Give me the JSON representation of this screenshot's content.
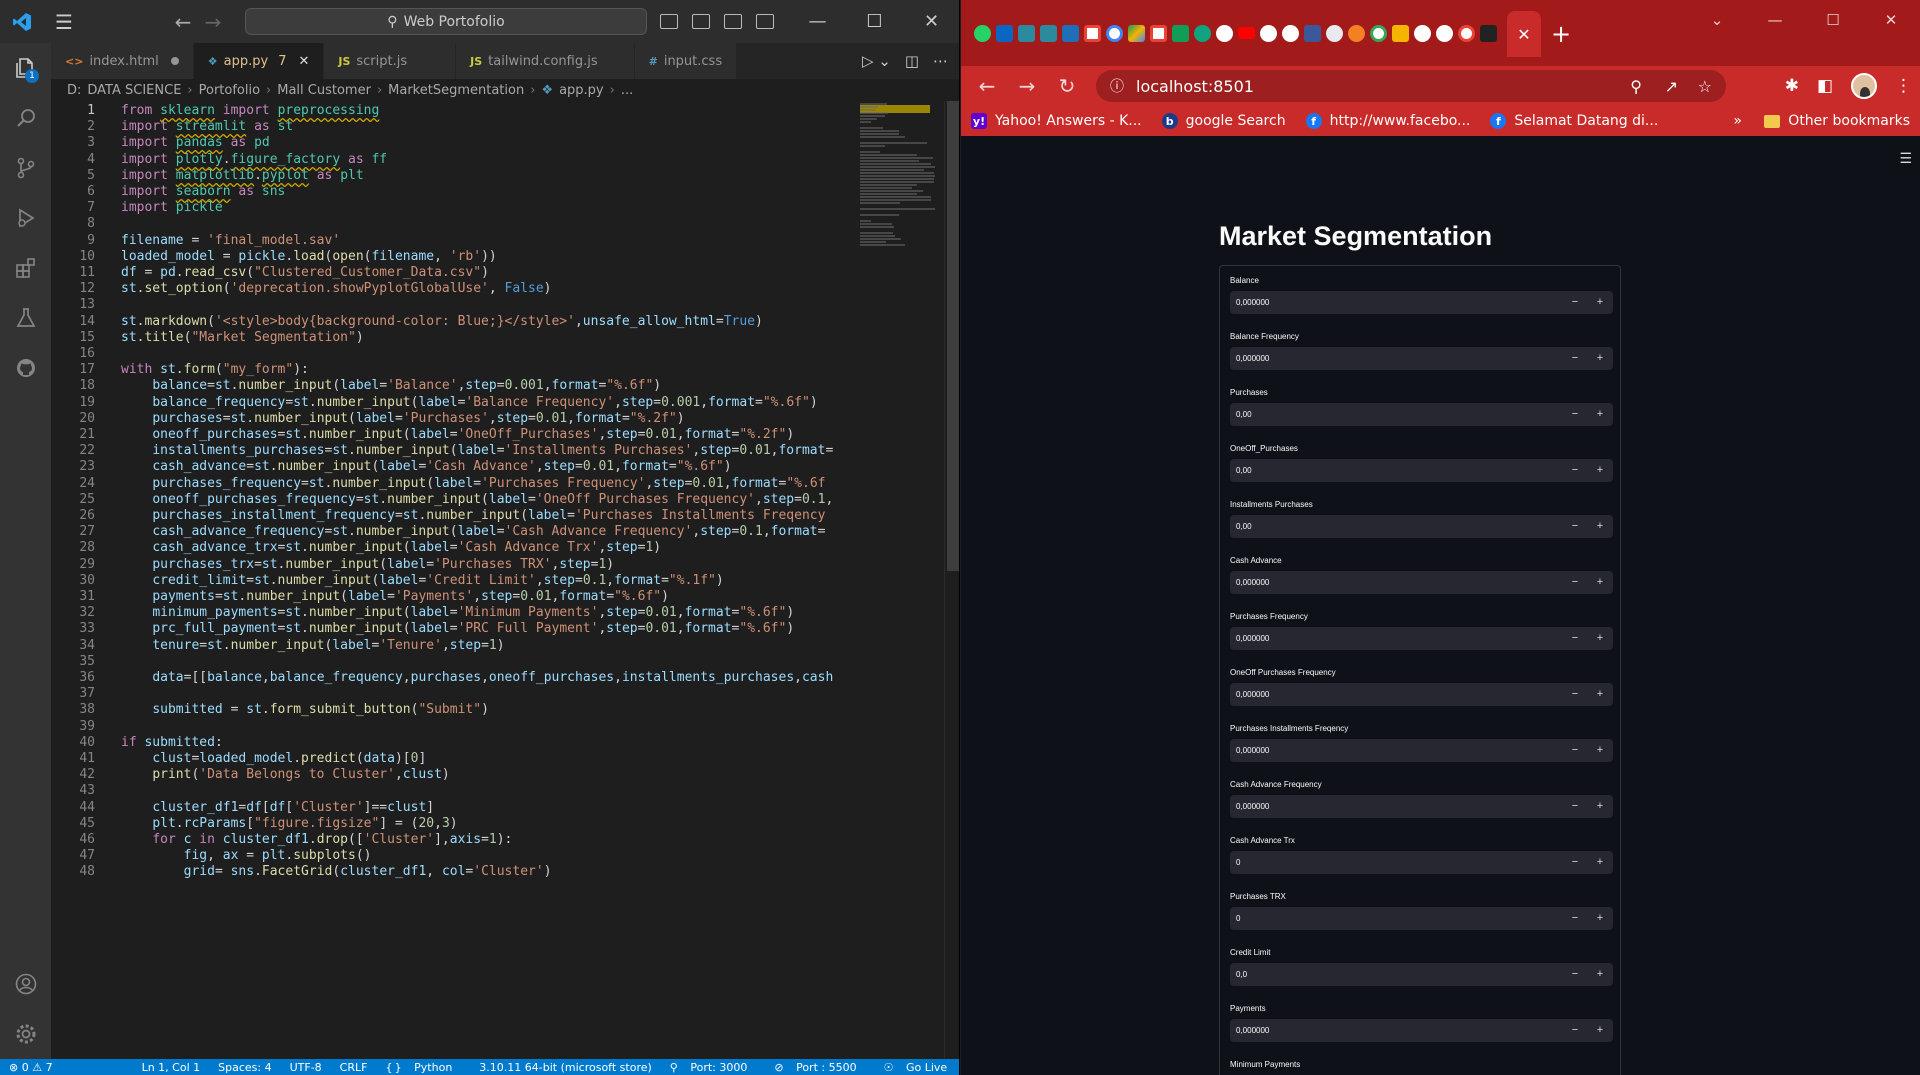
{
  "vscode": {
    "search_text": "Web Portofolio",
    "tabs": [
      {
        "name": "index.html",
        "icon": "<>",
        "kind": "html",
        "state": "unsaved"
      },
      {
        "name": "app.py",
        "icon": "py",
        "kind": "py",
        "state": "active",
        "problems": "7"
      },
      {
        "name": "script.js",
        "icon": "JS",
        "kind": "js",
        "state": ""
      },
      {
        "name": "tailwind.config.js",
        "icon": "JS",
        "kind": "js",
        "state": ""
      },
      {
        "name": "input.css",
        "icon": "#",
        "kind": "css",
        "state": ""
      }
    ],
    "explorer_badge": "1",
    "breadcrumb": [
      "D:",
      "DATA SCIENCE",
      "Portofolio",
      "Mall Customer",
      "MarketSegmentation",
      "app.py",
      "..."
    ],
    "code_lines": [
      "from sklearn import preprocessing",
      "import streamlit as st",
      "import pandas as pd",
      "import plotly.figure_factory as ff",
      "import matplotlib.pyplot as plt",
      "import seaborn as sns",
      "import pickle",
      "",
      "filename = 'final_model.sav'",
      "loaded_model = pickle.load(open(filename, 'rb'))",
      "df = pd.read_csv(\"Clustered_Customer_Data.csv\")",
      "st.set_option('deprecation.showPyplotGlobalUse', False)",
      "",
      "st.markdown('<style>body{background-color: Blue;}</style>',unsafe_allow_html=True)",
      "st.title(\"Market Segmentation\")",
      "",
      "with st.form(\"my_form\"):",
      "    balance=st.number_input(label='Balance',step=0.001,format=\"%.6f\")",
      "    balance_frequency=st.number_input(label='Balance Frequency',step=0.001,format=\"%.6f\")",
      "    purchases=st.number_input(label='Purchases',step=0.01,format=\"%.2f\")",
      "    oneoff_purchases=st.number_input(label='OneOff_Purchases',step=0.01,format=\"%.2f\")",
      "    installments_purchases=st.number_input(label='Installments Purchases',step=0.01,format=",
      "    cash_advance=st.number_input(label='Cash Advance',step=0.01,format=\"%.6f\")",
      "    purchases_frequency=st.number_input(label='Purchases Frequency',step=0.01,format=\"%.6f",
      "    oneoff_purchases_frequency=st.number_input(label='OneOff Purchases Frequency',step=0.1,",
      "    purchases_installment_frequency=st.number_input(label='Purchases Installments Freqency",
      "    cash_advance_frequency=st.number_input(label='Cash Advance Frequency',step=0.1,format=",
      "    cash_advance_trx=st.number_input(label='Cash Advance Trx',step=1)",
      "    purchases_trx=st.number_input(label='Purchases TRX',step=1)",
      "    credit_limit=st.number_input(label='Credit Limit',step=0.1,format=\"%.1f\")",
      "    payments=st.number_input(label='Payments',step=0.01,format=\"%.6f\")",
      "    minimum_payments=st.number_input(label='Minimum Payments',step=0.01,format=\"%.6f\")",
      "    prc_full_payment=st.number_input(label='PRC Full Payment',step=0.01,format=\"%.6f\")",
      "    tenure=st.number_input(label='Tenure',step=1)",
      "",
      "    data=[[balance,balance_frequency,purchases,oneoff_purchases,installments_purchases,cash",
      "",
      "    submitted = st.form_submit_button(\"Submit\")",
      "",
      "if submitted:",
      "    clust=loaded_model.predict(data)[0]",
      "    print('Data Belongs to Cluster',clust)",
      "",
      "    cluster_df1=df[df['Cluster']==clust]",
      "    plt.rcParams[\"figure.figsize\"] = (20,3)",
      "    for c in cluster_df1.drop(['Cluster'],axis=1):",
      "        fig, ax = plt.subplots()",
      "        grid= sns.FacetGrid(cluster_df1, col='Cluster')"
    ],
    "status": {
      "problems": "⊗ 0 ⚠ 7",
      "position": "Ln 1, Col 1",
      "spaces": "Spaces: 4",
      "encoding": "UTF-8",
      "eol": "CRLF",
      "language": "Python",
      "interpreter": "3.10.11 64-bit (microsoft store)",
      "port1": "Port: 3000",
      "port2": "Port : 5500",
      "golive": "Go Live"
    }
  },
  "chrome": {
    "url": "localhost:8501",
    "bookmarks": [
      "Yahoo! Answers - K...",
      "google Search",
      "http://www.facebo...",
      "Selamat Datang di..."
    ],
    "bookmarks_more": "»",
    "other_bookmarks": "Other bookmarks",
    "colors": {
      "frame": "#a31a1a",
      "toolbar": "#c92a2a"
    }
  },
  "streamlit": {
    "title": "Market Segmentation",
    "fields": [
      {
        "label": "Balance",
        "value": "0,000000"
      },
      {
        "label": "Balance Frequency",
        "value": "0,000000"
      },
      {
        "label": "Purchases",
        "value": "0,00"
      },
      {
        "label": "OneOff_Purchases",
        "value": "0,00"
      },
      {
        "label": "Installments Purchases",
        "value": "0,00"
      },
      {
        "label": "Cash Advance",
        "value": "0,000000"
      },
      {
        "label": "Purchases Frequency",
        "value": "0,000000"
      },
      {
        "label": "OneOff Purchases Frequency",
        "value": "0,000000"
      },
      {
        "label": "Purchases Installments Freqency",
        "value": "0,000000"
      },
      {
        "label": "Cash Advance Frequency",
        "value": "0,000000"
      },
      {
        "label": "Cash Advance Trx",
        "value": "0"
      },
      {
        "label": "Purchases TRX",
        "value": "0"
      },
      {
        "label": "Credit Limit",
        "value": "0,0"
      },
      {
        "label": "Payments",
        "value": "0,000000"
      },
      {
        "label": "Minimum Payments",
        "value": ""
      }
    ],
    "minus": "−",
    "plus": "+"
  }
}
